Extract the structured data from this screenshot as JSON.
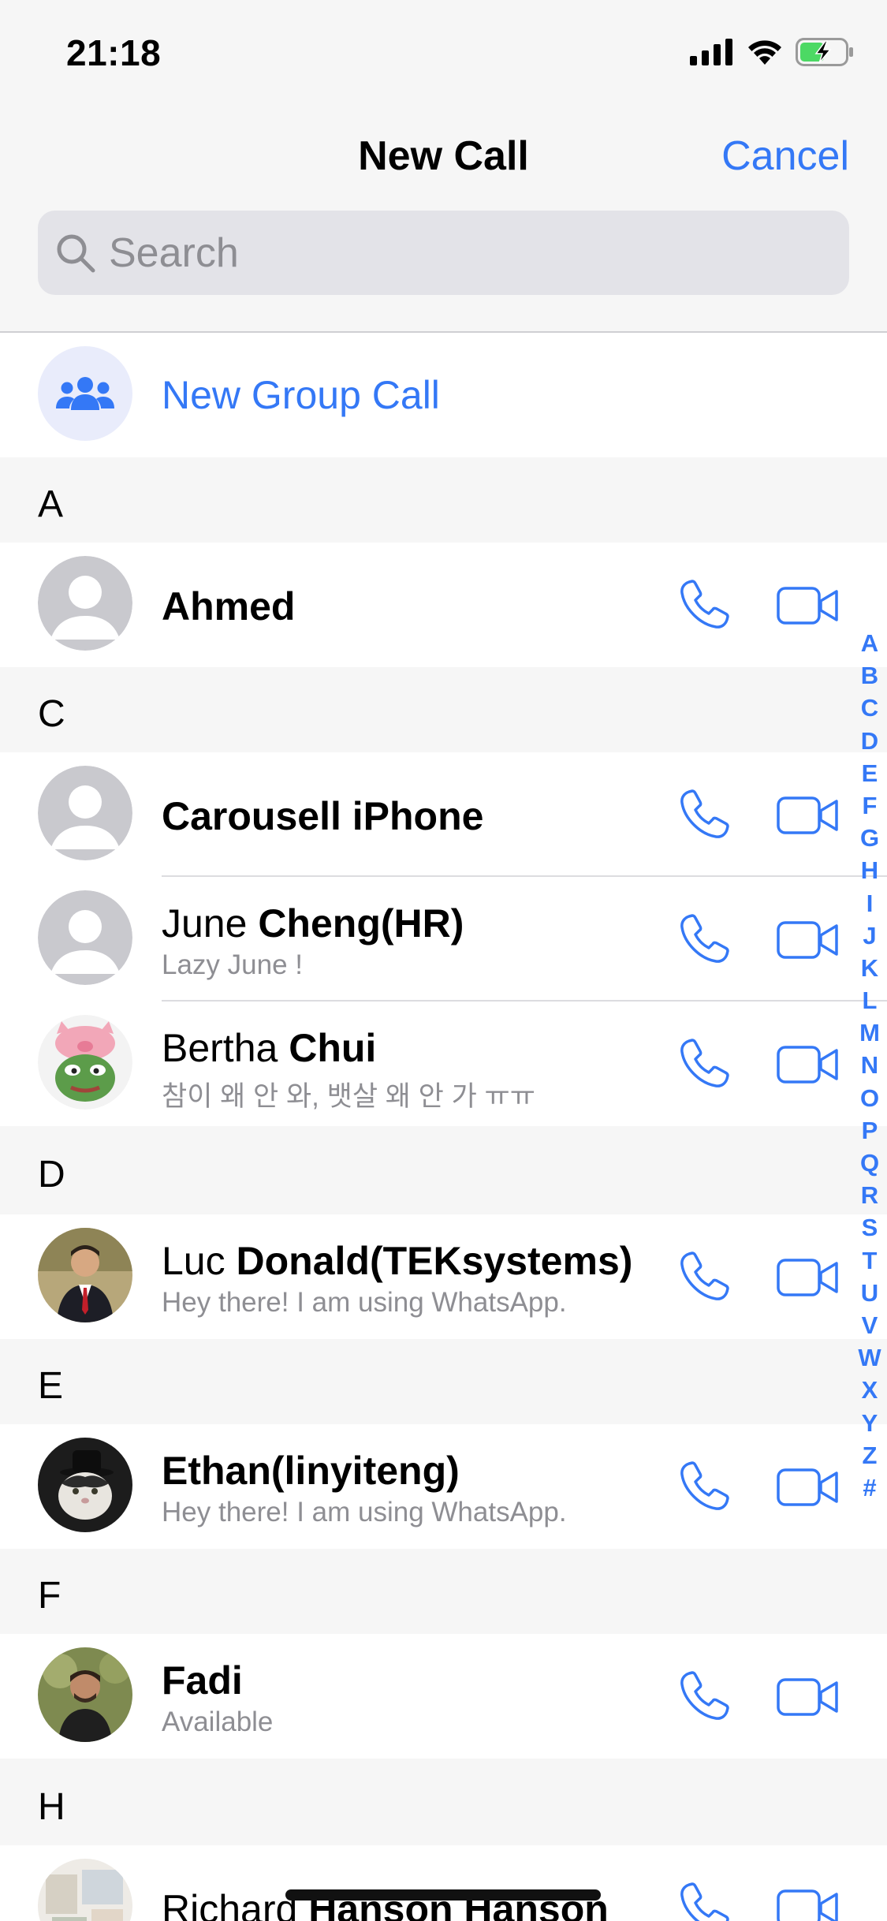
{
  "status_bar": {
    "time": "21:18"
  },
  "nav": {
    "title": "New Call",
    "cancel": "Cancel"
  },
  "search": {
    "placeholder": "Search"
  },
  "new_group_call": "New Group Call",
  "sections": {
    "a": "A",
    "c": "C",
    "d": "D",
    "e": "E",
    "f": "F",
    "h": "H"
  },
  "contacts": {
    "ahmed": {
      "name": "Ahmed"
    },
    "carousell": {
      "name": "Carousell iPhone"
    },
    "june": {
      "first": "June ",
      "last": "Cheng(HR)",
      "status": "Lazy June !"
    },
    "bertha": {
      "first": "Bertha ",
      "last": "Chui",
      "status": "참이 왜 안 와, 뱃살 왜 안 가 ㅠㅠ"
    },
    "luc": {
      "first": "Luc ",
      "last": "Donald(TEKsystems)",
      "status": "Hey there! I am using WhatsApp."
    },
    "ethan": {
      "name": "Ethan(linyiteng)",
      "status": "Hey there! I am using WhatsApp."
    },
    "fadi": {
      "name": "Fadi",
      "status": "Available"
    },
    "richard": {
      "first": "Richard ",
      "last": "Hanson Hanson"
    }
  },
  "index_letters": [
    "A",
    "B",
    "C",
    "D",
    "E",
    "F",
    "G",
    "H",
    "I",
    "J",
    "K",
    "L",
    "M",
    "N",
    "O",
    "P",
    "Q",
    "R",
    "S",
    "T",
    "U",
    "V",
    "W",
    "X",
    "Y",
    "Z",
    "#"
  ],
  "colors": {
    "accent": "#3478f6",
    "background": "#f6f6f6",
    "secondary_text": "#8e8e93"
  },
  "icons": [
    "signal-icon",
    "wifi-icon",
    "battery-charging-icon",
    "search-icon",
    "group-icon",
    "phone-icon",
    "video-icon"
  ]
}
